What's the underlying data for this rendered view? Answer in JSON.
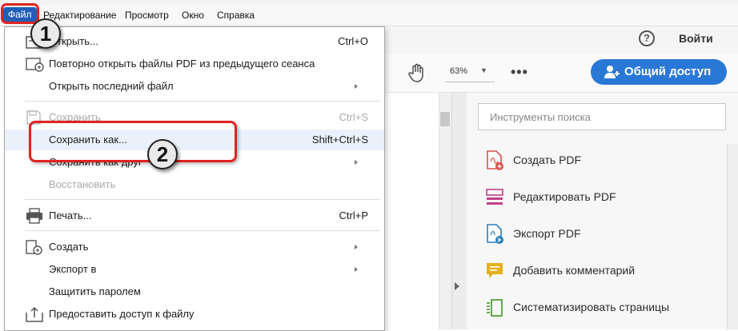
{
  "menubar": {
    "items": [
      "Файл",
      "Редактирование",
      "Просмотр",
      "Окно",
      "Справка"
    ]
  },
  "file_menu": {
    "items": [
      {
        "label": "Открыть...",
        "shortcut": "Ctrl+O",
        "icon": "open-folder-icon",
        "state": "enabled"
      },
      {
        "label": "Повторно открыть файлы PDF из предыдущего сеанса",
        "shortcut": "",
        "icon": "reopen-icon",
        "state": "enabled"
      },
      {
        "label": "Открыть последний файл",
        "shortcut": "",
        "submenu": true,
        "state": "enabled"
      },
      {
        "label": "Сохранить",
        "shortcut": "Ctrl+S",
        "icon": "save-icon",
        "state": "disabled"
      },
      {
        "label": "Сохранить как...",
        "shortcut": "Shift+Ctrl+S",
        "state": "highlighted"
      },
      {
        "label": "Сохранить как друг",
        "shortcut": "",
        "submenu": true,
        "state": "enabled"
      },
      {
        "label": "Восстановить",
        "shortcut": "",
        "state": "disabled"
      },
      {
        "label": "Печать...",
        "shortcut": "Ctrl+P",
        "icon": "printer-icon",
        "state": "enabled"
      },
      {
        "label": "Создать",
        "shortcut": "",
        "submenu": true,
        "icon": "create-icon",
        "state": "enabled"
      },
      {
        "label": "Экспорт в",
        "shortcut": "",
        "submenu": true,
        "state": "enabled"
      },
      {
        "label": "Защитить паролем",
        "shortcut": "",
        "state": "enabled"
      },
      {
        "label": "Предоставить доступ к файлу",
        "shortcut": "",
        "icon": "share-file-icon",
        "state": "enabled"
      }
    ]
  },
  "toolbar": {
    "help_label": "?",
    "signin_label": "Войти",
    "zoom_value": "63%",
    "share_button_label": "Общий доступ"
  },
  "right_panel": {
    "search_placeholder": "Инструменты поиска",
    "tools": [
      {
        "label": "Создать PDF",
        "icon": "create-pdf-icon",
        "color": "#d9534f"
      },
      {
        "label": "Редактировать PDF",
        "icon": "edit-pdf-icon",
        "color": "#c2418a"
      },
      {
        "label": "Экспорт PDF",
        "icon": "export-pdf-icon",
        "color": "#2f7fb8"
      },
      {
        "label": "Добавить комментарий",
        "icon": "comment-icon",
        "color": "#e3b21b"
      },
      {
        "label": "Систематизировать страницы",
        "icon": "organize-pages-icon",
        "color": "#4fa33a"
      }
    ]
  },
  "annotations": {
    "step1": "1",
    "step2": "2"
  },
  "colors": {
    "accent_blue": "#2a78d6",
    "highlight_red": "#e0231f",
    "menu_hover": "#eaf1fb"
  }
}
